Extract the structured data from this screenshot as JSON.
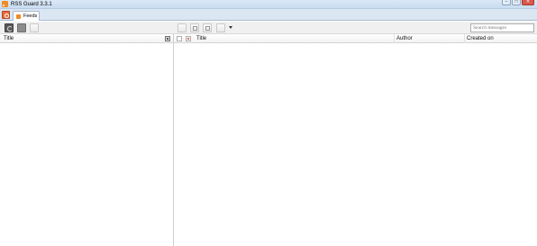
{
  "window": {
    "title": "RSS Guard 3.3.1",
    "icon": "rss-icon",
    "buttons": [
      "minimize",
      "maximize",
      "close"
    ]
  },
  "tabs": [
    {
      "label": "Feeds",
      "icon": "rss-icon",
      "active": true
    }
  ],
  "toolbar_left": [
    {
      "name": "update-all-feeds-button",
      "icon": "refresh-icon"
    },
    {
      "name": "stop-button",
      "icon": "stop-icon"
    },
    {
      "name": "add-feed-button",
      "icon": "blank-icon"
    }
  ],
  "toolbar_center": [
    {
      "name": "mark-read-button",
      "icon": "blank-icon"
    },
    {
      "name": "mark-important-button",
      "icon": "grid-icon"
    },
    {
      "name": "delete-message-button",
      "icon": "page-icon"
    },
    {
      "name": "open-in-browser-button",
      "icon": "blank-icon",
      "has_dropdown": true
    }
  ],
  "search": {
    "placeholder": "Search messages",
    "value": ""
  },
  "feeds_list": {
    "columns": [
      {
        "label": "Title"
      }
    ],
    "rows": []
  },
  "messages_list": {
    "columns": [
      {
        "label": ""
      },
      {
        "label": ""
      },
      {
        "label": "Title"
      },
      {
        "label": "Author"
      },
      {
        "label": "Created on"
      }
    ],
    "rows": []
  },
  "colors": {
    "titlebar": "#c9dcf0",
    "accent": "#f08a24",
    "close": "#d9574b"
  }
}
